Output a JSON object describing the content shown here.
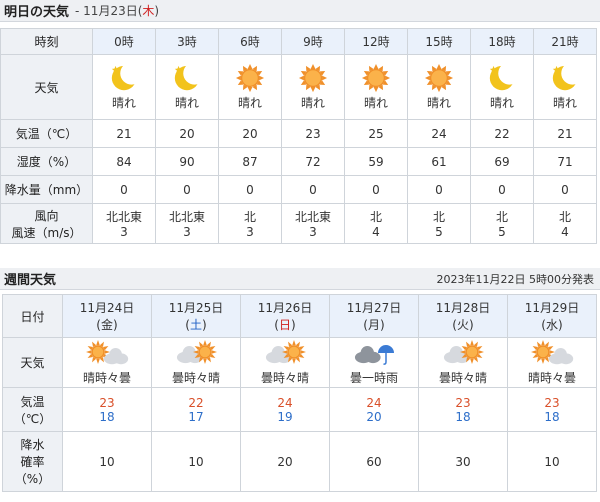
{
  "tomorrow": {
    "title": "明日の天気",
    "sep": " - ",
    "date": "11月23日(",
    "dow": "木",
    "date_close": ")",
    "labels": {
      "time": "時刻",
      "weather": "天気",
      "temp": "気温（℃）",
      "humidity": "湿度（%）",
      "precip": "降水量（mm）",
      "wind_dir": "風向",
      "wind_speed": "風速（m/s）"
    },
    "hours": [
      {
        "time": "0時",
        "icon": "moon-star-icon",
        "weather": "晴れ",
        "temp": "21",
        "humidity": "84",
        "precip": "0",
        "wind_dir": "北北東",
        "wind_speed": "3"
      },
      {
        "time": "3時",
        "icon": "moon-star-icon",
        "weather": "晴れ",
        "temp": "20",
        "humidity": "90",
        "precip": "0",
        "wind_dir": "北北東",
        "wind_speed": "3"
      },
      {
        "time": "6時",
        "icon": "sun-icon",
        "weather": "晴れ",
        "temp": "20",
        "humidity": "87",
        "precip": "0",
        "wind_dir": "北",
        "wind_speed": "3"
      },
      {
        "time": "9時",
        "icon": "sun-icon",
        "weather": "晴れ",
        "temp": "23",
        "humidity": "72",
        "precip": "0",
        "wind_dir": "北北東",
        "wind_speed": "3"
      },
      {
        "time": "12時",
        "icon": "sun-icon",
        "weather": "晴れ",
        "temp": "25",
        "humidity": "59",
        "precip": "0",
        "wind_dir": "北",
        "wind_speed": "4"
      },
      {
        "time": "15時",
        "icon": "sun-icon",
        "weather": "晴れ",
        "temp": "24",
        "humidity": "61",
        "precip": "0",
        "wind_dir": "北",
        "wind_speed": "5"
      },
      {
        "time": "18時",
        "icon": "moon-star-icon",
        "weather": "晴れ",
        "temp": "22",
        "humidity": "69",
        "precip": "0",
        "wind_dir": "北",
        "wind_speed": "5"
      },
      {
        "time": "21時",
        "icon": "moon-star-icon",
        "weather": "晴れ",
        "temp": "21",
        "humidity": "71",
        "precip": "0",
        "wind_dir": "北",
        "wind_speed": "4"
      }
    ]
  },
  "weekly": {
    "title": "週間天気",
    "published": "2023年11月22日 5時00分発表",
    "labels": {
      "date": "日付",
      "weather": "天気",
      "temp_1": "気温",
      "temp_2": "（℃）",
      "pop_1": "降水",
      "pop_2": "確率",
      "pop_3": "（%）"
    },
    "days": [
      {
        "date": "11月24日",
        "dow": "金",
        "dow_color": "#333333",
        "icon": "sun-cloud-icon",
        "weather": "晴時々曇",
        "high": "23",
        "low": "18",
        "pop": "10"
      },
      {
        "date": "11月25日",
        "dow": "土",
        "dow_color": "#1f5fc4",
        "icon": "cloud-sun-icon",
        "weather": "曇時々晴",
        "high": "22",
        "low": "17",
        "pop": "10"
      },
      {
        "date": "11月26日",
        "dow": "日",
        "dow_color": "#d02020",
        "icon": "cloud-sun-icon",
        "weather": "曇時々晴",
        "high": "24",
        "low": "19",
        "pop": "20"
      },
      {
        "date": "11月27日",
        "dow": "月",
        "dow_color": "#333333",
        "icon": "cloud-umbrella-icon",
        "weather": "曇一時雨",
        "high": "24",
        "low": "20",
        "pop": "60"
      },
      {
        "date": "11月28日",
        "dow": "火",
        "dow_color": "#333333",
        "icon": "cloud-sun-icon",
        "weather": "曇時々晴",
        "high": "23",
        "low": "18",
        "pop": "30"
      },
      {
        "date": "11月29日",
        "dow": "水",
        "dow_color": "#333333",
        "icon": "sun-cloud-icon",
        "weather": "晴時々曇",
        "high": "23",
        "low": "18",
        "pop": "10"
      }
    ]
  },
  "colors": {
    "sun": "#f0902a",
    "moon": "#f2c31c",
    "cloud": "#d6d9de",
    "rain_cloud": "#8e949c",
    "umbrella": "#3b7bd4",
    "high_temp": "#d9502a",
    "low_temp": "#2d6ec9"
  }
}
